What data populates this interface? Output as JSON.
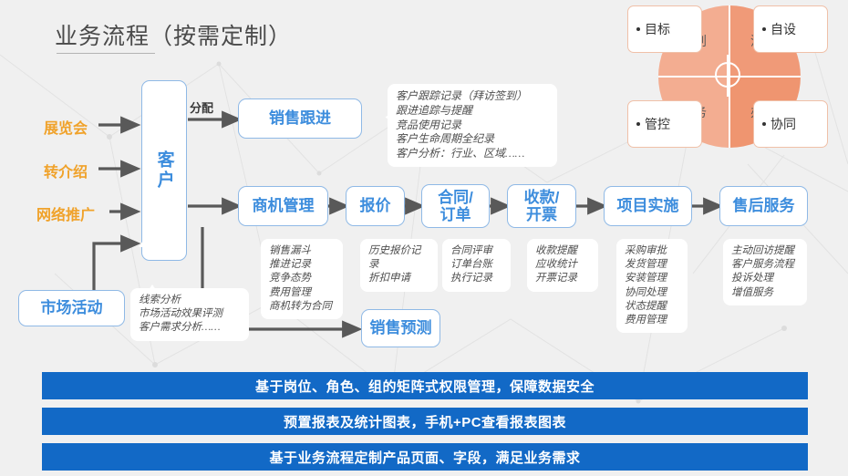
{
  "header": {
    "title": "业务流程（按需定制）"
  },
  "sources": [
    {
      "label": "展览会"
    },
    {
      "label": "转介绍"
    },
    {
      "label": "网络推广"
    }
  ],
  "arrow_labels": {
    "assign": "分配"
  },
  "nodes": {
    "customer": "客户",
    "market_activity": "市场活动",
    "sales_follow": "销售跟进",
    "opportunity": "商机管理",
    "quotation": "报价",
    "contract_order": "合同/\n订单",
    "payment_invoice": "收款/\n开票",
    "project_impl": "项目实施",
    "after_sales": "售后服务",
    "sales_forecast": "销售预测"
  },
  "notes": {
    "sales_follow": "客户跟踪记录（拜访签到）\n跟进追踪与提醒\n竞品使用记录\n客户生命周期全纪录\n客户分析：行业、区域……",
    "market_activity": "线索分析\n市场活动效果评测\n客户需求分析……",
    "opportunity": "销售漏斗\n推进记录\n竞争态势\n费用管理\n商机转为合同",
    "quotation": "历史报价记录\n折扣申请",
    "contract_order": "合同评审\n订单台账\n执行记录",
    "payment_invoice": "收款提醒\n应收统计\n开票记录",
    "project_impl": "采购审批\n发货管理\n安装管理\n协同处理\n状态提醒\n费用管理",
    "after_sales": "主动回访提醒\n客户服务流程\n投诉处理\n增值服务"
  },
  "circle": {
    "quadrants": {
      "top_left": "计划",
      "top_right": "流程",
      "bottom_left": "财务",
      "bottom_right": "办公"
    },
    "corners": {
      "top_left": "目标",
      "top_right": "自设",
      "bottom_left": "管控",
      "bottom_right": "协同"
    }
  },
  "banners": [
    "基于岗位、角色、组的矩阵式权限管理，保障数据安全",
    "预置报表及统计图表，手机+PC查看报表图表",
    "基于业务流程定制产品页面、字段，满足业务需求"
  ],
  "colors": {
    "accent_blue": "#3d8ddd",
    "banner_blue": "#1269c6",
    "source_orange": "#f0a22a",
    "circle_salmon": "#f0a078"
  }
}
